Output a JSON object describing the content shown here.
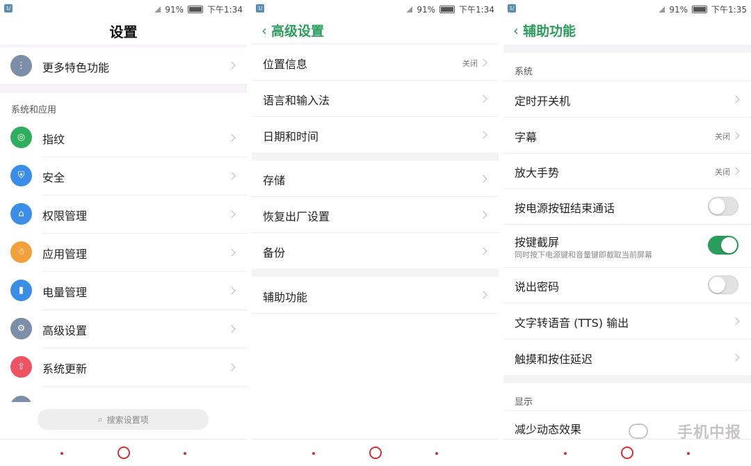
{
  "colors": {
    "accent": "#2a9d5c",
    "nav": "#d03030"
  },
  "panel1": {
    "status": {
      "battery": "91%",
      "time": "下午1:34"
    },
    "title": "设置",
    "more_features": "更多特色功能",
    "section": "系统和应用",
    "items": [
      {
        "label": "指纹",
        "icon": "fingerprint-icon",
        "color": "#2fae5f"
      },
      {
        "label": "安全",
        "icon": "shield-icon",
        "color": "#3b8ee8"
      },
      {
        "label": "权限管理",
        "icon": "key-icon",
        "color": "#3b8ee8"
      },
      {
        "label": "应用管理",
        "icon": "android-icon",
        "color": "#f2a13a"
      },
      {
        "label": "电量管理",
        "icon": "battery-icon",
        "color": "#3b8ee8"
      },
      {
        "label": "高级设置",
        "icon": "gear-icon",
        "color": "#7d8ea8"
      },
      {
        "label": "系统更新",
        "icon": "update-arrow-icon",
        "color": "#ee5361"
      }
    ],
    "search_placeholder": "搜索设置项"
  },
  "panel2": {
    "status": {
      "battery": "91%",
      "time": "下午1:34"
    },
    "title": "高级设置",
    "location": {
      "label": "位置信息",
      "value": "关闭"
    },
    "language": "语言和输入法",
    "datetime": "日期和时间",
    "storage": "存储",
    "factory_reset": "恢复出厂设置",
    "backup": "备份",
    "accessibility": "辅助功能"
  },
  "panel3": {
    "status": {
      "battery": "91%",
      "time": "下午1:35"
    },
    "title": "辅助功能",
    "section_system": "系统",
    "scheduled_power": "定时开关机",
    "captions": {
      "label": "字幕",
      "value": "关闭"
    },
    "magnify": {
      "label": "放大手势",
      "value": "关闭"
    },
    "power_end_call": {
      "label": "按电源按钮结束通话",
      "on": false
    },
    "key_screenshot": {
      "label": "按键截屏",
      "sub": "同时按下电源键和音量键即截取当前屏幕",
      "on": true
    },
    "speak_password": {
      "label": "说出密码",
      "on": false
    },
    "tts": "文字转语音 (TTS) 输出",
    "touch_delay": "触摸和按住延迟",
    "section_display": "显示",
    "reduce_motion": "减少动态效果"
  },
  "watermark": "手机中报"
}
